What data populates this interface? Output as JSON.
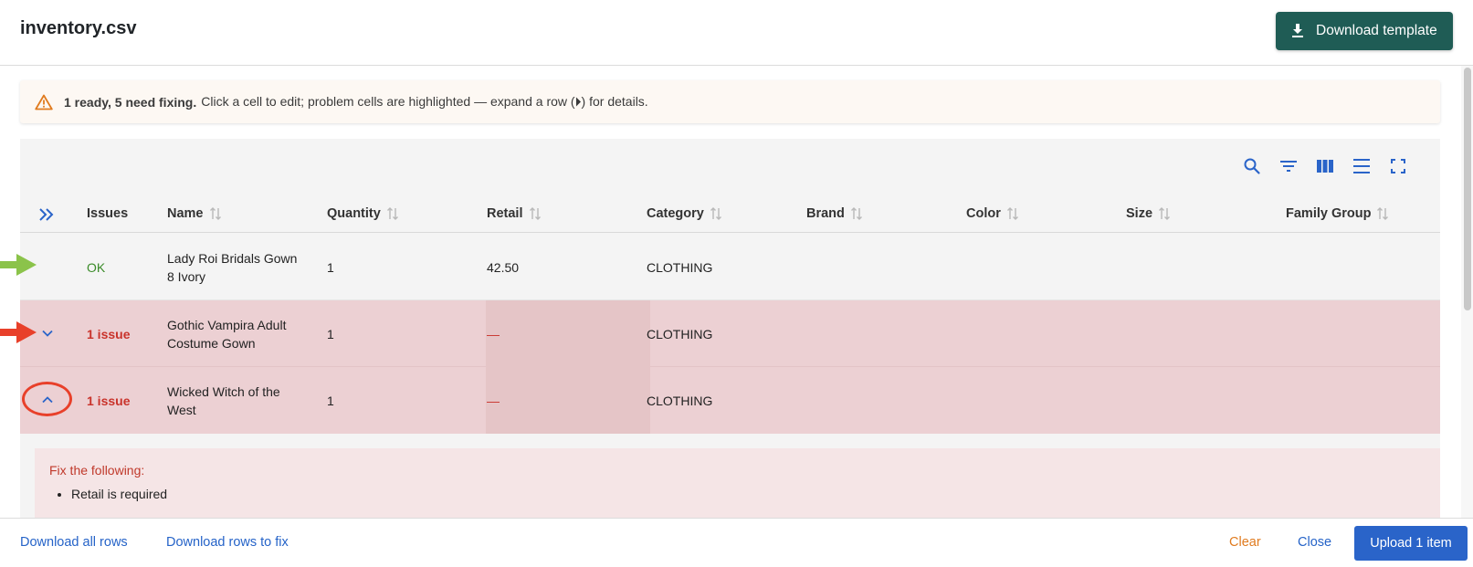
{
  "header": {
    "title": "inventory.csv",
    "download_template_label": "Download template"
  },
  "alert": {
    "bold": "1 ready, 5 need fixing.",
    "text": "Click a cell to edit; problem cells are highlighted — expand a row (⏵) for details."
  },
  "table": {
    "columns": [
      "Issues",
      "Name",
      "Quantity",
      "Retail",
      "Category",
      "Brand",
      "Color",
      "Size",
      "Family Group"
    ],
    "rows": [
      {
        "status": "OK",
        "name_line1": "Lady Roi Bridals Gown",
        "name_line2": "8 Ivory",
        "quantity": "1",
        "retail": "42.50",
        "category": "CLOTHING"
      },
      {
        "status": "1 issue",
        "name_line1": "Gothic Vampira Adult",
        "name_line2": "Costume Gown",
        "quantity": "1",
        "retail": "—",
        "category": "CLOTHING"
      },
      {
        "status": "1 issue",
        "name_line1": "Wicked Witch of the",
        "name_line2": "West",
        "quantity": "1",
        "retail": "—",
        "category": "CLOTHING"
      }
    ],
    "detail": {
      "heading": "Fix the following:",
      "items": [
        "Retail is required"
      ]
    }
  },
  "footer": {
    "download_all": "Download all rows",
    "download_fix": "Download rows to fix",
    "clear": "Clear",
    "close": "Close",
    "upload": "Upload 1 item"
  },
  "colors": {
    "primary": "#2a64c9",
    "template_button": "#1f5c55",
    "error": "#c9332b",
    "ok": "#3a8b28",
    "error_row": "#ecd0d3",
    "annotation_green": "#8bc34a",
    "annotation_red": "#e8402a"
  },
  "icons": [
    "download-icon",
    "warning-icon",
    "search-icon",
    "filter-icon",
    "columns-icon",
    "density-icon",
    "fullscreen-icon",
    "expand-all-icon",
    "sort-icon",
    "chevron-down-icon",
    "chevron-up-icon"
  ]
}
